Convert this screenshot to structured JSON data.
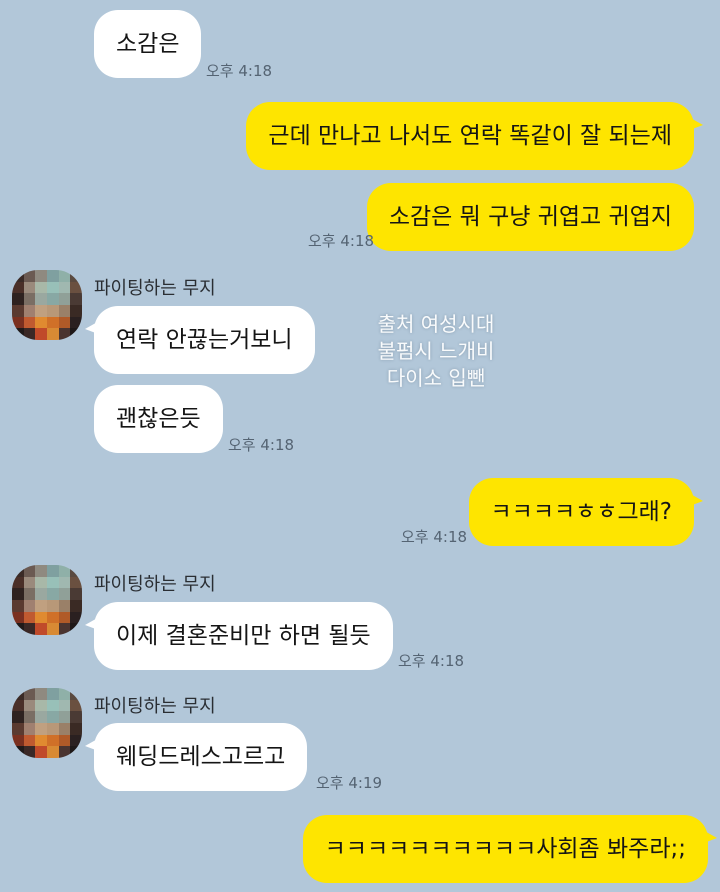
{
  "colors": {
    "chat_background": "#b2c7d9",
    "incoming_bubble": "#ffffff",
    "outgoing_bubble": "#fee500"
  },
  "contact": {
    "name": "파이팅하는 무지",
    "avatar_icon": "pixelated-avatar"
  },
  "messages": [
    {
      "from": "contact",
      "text": "소감은",
      "time": "오후 4:18"
    },
    {
      "from": "me",
      "text": "근데 만나고 나서도 연락 똑같이 잘 되는제"
    },
    {
      "from": "me",
      "text": "소감은 뭐 구냥 귀엽고 귀엽지",
      "time": "오후 4:18"
    },
    {
      "from": "contact",
      "sender": "파이팅하는 무지",
      "text": "연락 안끊는거보니"
    },
    {
      "from": "contact",
      "text": "괜찮은듯",
      "time": "오후 4:18"
    },
    {
      "from": "me",
      "text": "ㅋㅋㅋㅋㅎㅎ그래?",
      "time": "오후 4:18"
    },
    {
      "from": "contact",
      "sender": "파이팅하는 무지",
      "text": "이제 결혼준비만 하면 될듯",
      "time": "오후 4:18"
    },
    {
      "from": "contact",
      "sender": "파이팅하는 무지",
      "text": "웨딩드레스고르고",
      "time": "오후 4:19"
    },
    {
      "from": "me",
      "text": "ㅋㅋㅋㅋㅋㅋㅋㅋㅋㅋ사회좀 봐주라;;"
    }
  ],
  "watermark": {
    "line1": "출처 여성시대",
    "line2": "불펌시 느개비",
    "line3": "다이소 입뺀"
  }
}
